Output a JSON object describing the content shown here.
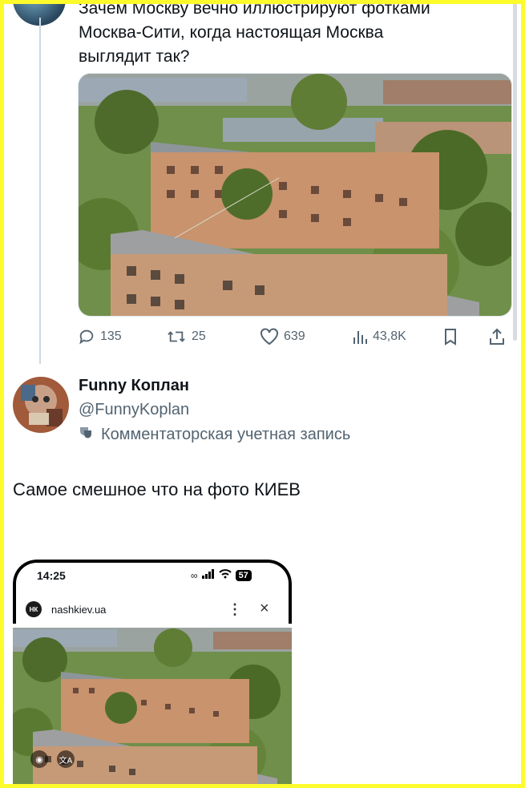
{
  "tweet": {
    "text_line1": "Зачем Москву вечно иллюстрируют фотками",
    "text_line2": "Москва-Сити, когда настоящая Москва",
    "text_line3": "выглядит так?",
    "photo_icon": "city-apartments-photo",
    "stats": {
      "replies": "135",
      "retweets": "25",
      "likes": "639",
      "views": "43,8K"
    }
  },
  "reply": {
    "name": "Funny Коплан",
    "handle": "@FunnyKoplan",
    "account_label": "Комментаторская учетная запись",
    "text": "Самое смешное что на фото КИЕВ"
  },
  "phone_screenshot": {
    "time": "14:25",
    "battery": "57",
    "site_icon_text": "НК",
    "site": "nashkiev.ua"
  },
  "colors": {
    "frame": "#fdfb2c",
    "muted": "#536471"
  }
}
